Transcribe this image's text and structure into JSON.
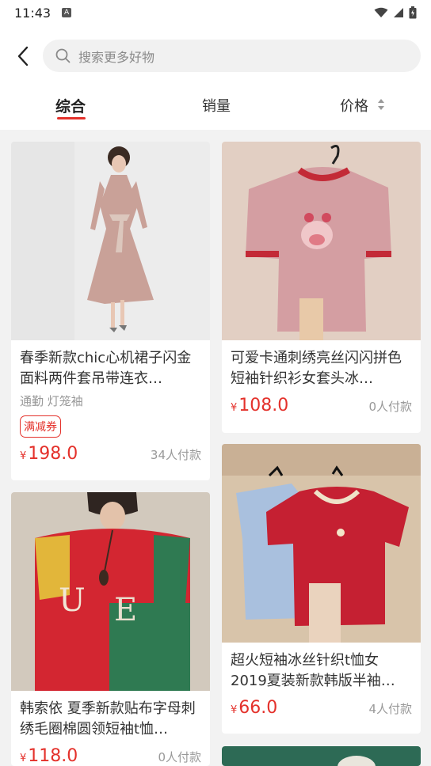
{
  "status": {
    "time": "11:43",
    "a_badge": "A"
  },
  "search": {
    "placeholder": "搜索更多好物"
  },
  "tabs": [
    {
      "label": "综合",
      "active": true
    },
    {
      "label": "销量",
      "active": false
    },
    {
      "label": "价格",
      "active": false
    }
  ],
  "products": [
    {
      "title": "春季新款chic心机裙子闪金面料两件套吊带连衣…",
      "shop": "通勤 灯笼袖",
      "coupon": "满减券",
      "yen": "¥",
      "price": "198.0",
      "sold": "34人付款"
    },
    {
      "title": "可爱卡通刺绣亮丝闪闪拼色短袖针织衫女套头冰…",
      "yen": "¥",
      "price": "108.0",
      "sold": "0人付款"
    },
    {
      "title": "超火短袖冰丝针织t恤女2019夏装新款韩版半袖…",
      "yen": "¥",
      "price": "66.0",
      "sold": "4人付款"
    },
    {
      "title": "韩索依 夏季新款贴布字母刺绣毛圈棉圆领短袖t恤…",
      "yen": "¥",
      "price": "118.0",
      "sold": "0人付款"
    }
  ],
  "colors": {
    "accent": "#e4312b",
    "background": "#f2f2f2"
  }
}
